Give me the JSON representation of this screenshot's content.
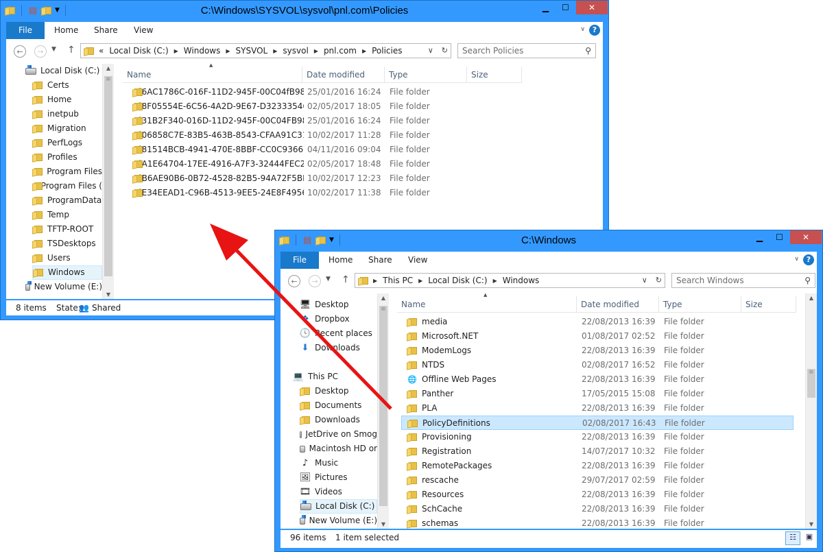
{
  "win1": {
    "title": "C:\\Windows\\SYSVOL\\sysvol\\pnl.com\\Policies",
    "tabs": [
      "File",
      "Home",
      "Share",
      "View"
    ],
    "address": {
      "crumbs": [
        "«",
        "Local Disk (C:)",
        "Windows",
        "SYSVOL",
        "sysvol",
        "pnl.com",
        "Policies"
      ]
    },
    "search_placeholder": "Search Policies",
    "nav": [
      {
        "label": "Local Disk (C:)",
        "icon": "drive-icon"
      },
      {
        "label": "Certs",
        "icon": "folder-icon"
      },
      {
        "label": "Home",
        "icon": "folder-icon"
      },
      {
        "label": "inetpub",
        "icon": "folder-icon"
      },
      {
        "label": "Migration",
        "icon": "folder-icon"
      },
      {
        "label": "PerfLogs",
        "icon": "folder-icon"
      },
      {
        "label": "Profiles",
        "icon": "folder-icon"
      },
      {
        "label": "Program Files",
        "icon": "folder-icon"
      },
      {
        "label": "Program Files (",
        "icon": "folder-icon"
      },
      {
        "label": "ProgramData",
        "icon": "folder-icon"
      },
      {
        "label": "Temp",
        "icon": "folder-icon"
      },
      {
        "label": "TFTP-ROOT",
        "icon": "folder-icon"
      },
      {
        "label": "TSDesktops",
        "icon": "folder-icon"
      },
      {
        "label": "Users",
        "icon": "folder-icon"
      },
      {
        "label": "Windows",
        "icon": "folder-icon"
      },
      {
        "label": "New Volume (E:)",
        "icon": "drive-icon"
      }
    ],
    "columns": [
      "Name",
      "Date modified",
      "Type",
      "Size"
    ],
    "rows": [
      {
        "name": "{6AC1786C-016F-11D2-945F-00C04fB984...",
        "date": "25/01/2016 16:24",
        "type": "File folder"
      },
      {
        "name": "{8F05554E-6C56-4A2D-9E67-D323335465...",
        "date": "02/05/2017 18:05",
        "type": "File folder"
      },
      {
        "name": "{31B2F340-016D-11D2-945F-00C04FB984...",
        "date": "25/01/2016 16:24",
        "type": "File folder"
      },
      {
        "name": "{06858C7E-83B5-463B-8543-CFAA91C319...",
        "date": "10/02/2017 11:28",
        "type": "File folder"
      },
      {
        "name": "{81514BCB-4941-470E-8BBF-CC0C93662E...",
        "date": "04/11/2016 09:04",
        "type": "File folder"
      },
      {
        "name": "{A1E64704-17EE-4916-A7F3-32444FEC2583}",
        "date": "02/05/2017 18:48",
        "type": "File folder"
      },
      {
        "name": "{B6AE90B6-0B72-4528-82B5-94A72F5BB9...",
        "date": "10/02/2017 12:23",
        "type": "File folder"
      },
      {
        "name": "{E34EEAD1-C96B-4513-9EE5-24E8F49568...",
        "date": "10/02/2017 11:38",
        "type": "File folder"
      }
    ],
    "status": {
      "count": "8 items",
      "state_label": "State:",
      "state_value": "Shared"
    }
  },
  "win2": {
    "title": "C:\\Windows",
    "tabs": [
      "File",
      "Home",
      "Share",
      "View"
    ],
    "address": {
      "crumbs": [
        "This PC",
        "Local Disk (C:)",
        "Windows"
      ]
    },
    "search_placeholder": "Search Windows",
    "nav": [
      {
        "label": "Desktop",
        "icon": "desktop-icon"
      },
      {
        "label": "Dropbox",
        "icon": "dropbox-icon"
      },
      {
        "label": "Recent places",
        "icon": "recent-places-icon"
      },
      {
        "label": "Downloads",
        "icon": "downloads-icon"
      },
      {
        "label": "This PC",
        "icon": "computer-icon"
      },
      {
        "label": "Desktop",
        "icon": "folder-icon"
      },
      {
        "label": "Documents",
        "icon": "folder-icon"
      },
      {
        "label": "Downloads",
        "icon": "folder-icon"
      },
      {
        "label": "JetDrive on Smog",
        "icon": "network-drive-icon"
      },
      {
        "label": "Macintosh HD or",
        "icon": "network-drive-icon"
      },
      {
        "label": "Music",
        "icon": "music-icon"
      },
      {
        "label": "Pictures",
        "icon": "pictures-icon"
      },
      {
        "label": "Videos",
        "icon": "videos-icon"
      },
      {
        "label": "Local Disk (C:)",
        "icon": "drive-icon"
      },
      {
        "label": "New Volume (E:)",
        "icon": "drive-icon"
      }
    ],
    "columns": [
      "Name",
      "Date modified",
      "Type",
      "Size"
    ],
    "rows": [
      {
        "name": "media",
        "date": "22/08/2013 16:39",
        "type": "File folder"
      },
      {
        "name": "Microsoft.NET",
        "date": "01/08/2017 02:52",
        "type": "File folder"
      },
      {
        "name": "ModemLogs",
        "date": "22/08/2013 16:39",
        "type": "File folder"
      },
      {
        "name": "NTDS",
        "date": "02/08/2017 16:52",
        "type": "File folder"
      },
      {
        "name": "Offline Web Pages",
        "date": "22/08/2013 16:39",
        "type": "File folder"
      },
      {
        "name": "Panther",
        "date": "17/05/2015 15:08",
        "type": "File folder"
      },
      {
        "name": "PLA",
        "date": "22/08/2013 16:39",
        "type": "File folder"
      },
      {
        "name": "PolicyDefinitions",
        "date": "02/08/2017 16:43",
        "type": "File folder"
      },
      {
        "name": "Provisioning",
        "date": "22/08/2013 16:39",
        "type": "File folder"
      },
      {
        "name": "Registration",
        "date": "14/07/2017 10:32",
        "type": "File folder"
      },
      {
        "name": "RemotePackages",
        "date": "22/08/2013 16:39",
        "type": "File folder"
      },
      {
        "name": "rescache",
        "date": "29/07/2017 02:59",
        "type": "File folder"
      },
      {
        "name": "Resources",
        "date": "22/08/2013 16:39",
        "type": "File folder"
      },
      {
        "name": "SchCache",
        "date": "22/08/2013 16:39",
        "type": "File folder"
      },
      {
        "name": "schemas",
        "date": "22/08/2013 16:39",
        "type": "File folder"
      }
    ],
    "status": {
      "count": "96 items",
      "selected": "1 item selected"
    }
  },
  "colors": {
    "titlebar": "#3399ff",
    "close": "#c75050",
    "file_tab": "#1979ca",
    "selection": "#cce8ff",
    "arrow": "#e81313"
  }
}
